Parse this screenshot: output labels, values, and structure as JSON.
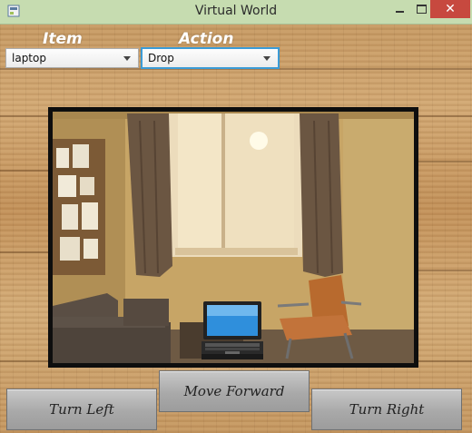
{
  "window": {
    "title": "Virtual World",
    "close_glyph": "✕"
  },
  "labels": {
    "item": "Item",
    "action": "Action"
  },
  "item_select": {
    "selected": "laptop"
  },
  "action_select": {
    "selected": "Drop"
  },
  "scene": {
    "object_icon": "laptop-icon"
  },
  "buttons": {
    "turn_left": "Turn Left",
    "move_forward": "Move Forward",
    "turn_right": "Turn Right"
  },
  "colors": {
    "titlebar": "#c6dcb0",
    "close_button": "#c7493f",
    "focus_border": "#3c9bd6",
    "frame": "#0e0e0e"
  }
}
